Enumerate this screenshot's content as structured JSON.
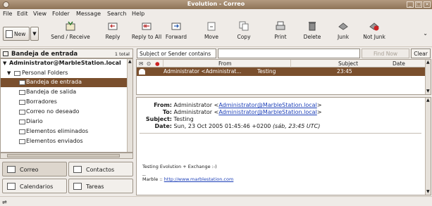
{
  "window": {
    "title": "Evolution - Correo"
  },
  "menu": [
    "File",
    "Edit",
    "View",
    "Folder",
    "Message",
    "Search",
    "Help"
  ],
  "toolbar": {
    "new_label": "New",
    "send_receive": "Send / Receive",
    "reply": "Reply",
    "reply_all": "Reply to All",
    "forward": "Forward",
    "move": "Move",
    "copy": "Copy",
    "print": "Print",
    "delete": "Delete",
    "junk": "Junk",
    "not_junk": "Not Junk"
  },
  "folder_header": {
    "title": "Bandeja de entrada",
    "count": "1 total"
  },
  "tree": {
    "account": "Administrator@MarbleStation.local",
    "personal": "Personal Folders",
    "folders": [
      "Bandeja de entrada",
      "Bandeja de salida",
      "Borradores",
      "Correo no deseado",
      "Diario",
      "Elementos eliminados",
      "Elementos enviados"
    ]
  },
  "switcher": {
    "correo": "Correo",
    "contactos": "Contactos",
    "calendarios": "Calendarios",
    "tareas": "Tareas"
  },
  "search": {
    "filter": "Subject or Sender contains",
    "query": "",
    "find_now": "Find Now",
    "clear": "Clear"
  },
  "message_list": {
    "columns": {
      "from": "From",
      "subject": "Subject",
      "date": "Date"
    },
    "rows": [
      {
        "from": "Administrator <Administrat...",
        "subject": "Testing",
        "date": "23:45"
      }
    ]
  },
  "preview": {
    "from_label": "From:",
    "from_name": "Administrator <",
    "from_email": "Administrator@MarbleStation.local",
    "to_label": "To:",
    "to_name": "Administrator <",
    "to_email": "Administrator@MarbleStation.local",
    "subject_label": "Subject:",
    "subject": "Testing",
    "date_label": "Date:",
    "date": "Sun, 23 Oct 2005 01:45:46 +0200",
    "date_local": "(sáb, 23:45 UTC)",
    "body_line1": "Testing Evolution + Exchange :-)",
    "body_sig_dash": "--",
    "body_sig_prefix": "Marble :: ",
    "body_sig_link": "http://www.marblestation.com"
  },
  "colors": {
    "selection": "#7a4f2d",
    "titlebar": "#8e7357",
    "link": "#1c3fb8"
  }
}
